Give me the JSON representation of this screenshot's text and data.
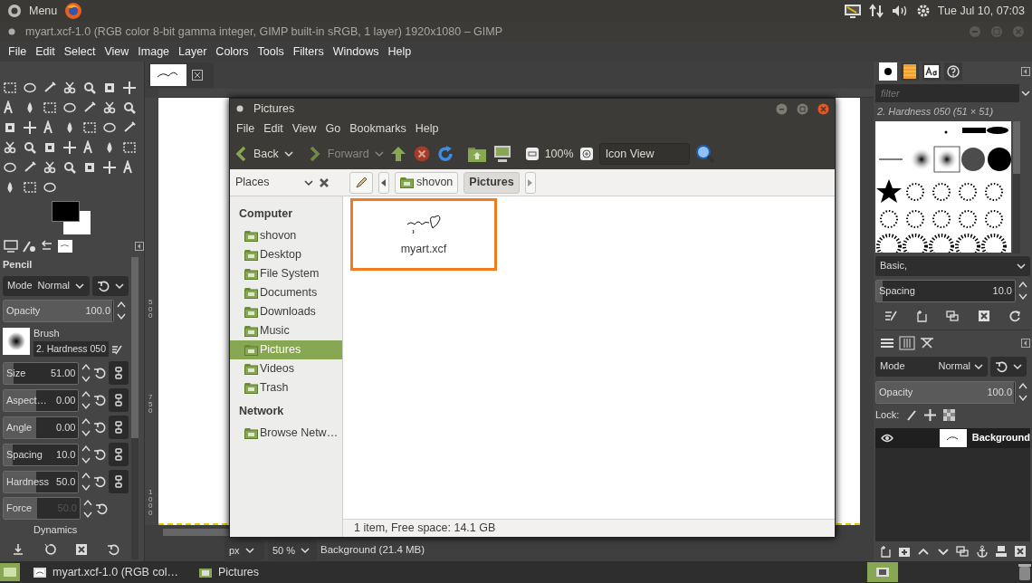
{
  "top_panel": {
    "menu": "Menu",
    "clock": "Tue Jul 10, 07:03"
  },
  "window": {
    "title": "myart.xcf-1.0 (RGB color 8-bit gamma integer, GIMP built-in sRGB, 1 layer) 1920x1080 – GIMP"
  },
  "menu_bar": [
    "File",
    "Edit",
    "Select",
    "View",
    "Image",
    "Layer",
    "Colors",
    "Tools",
    "Filters",
    "Windows",
    "Help"
  ],
  "tool_options": {
    "title": "Pencil",
    "mode": {
      "label": "Mode",
      "value": "Normal"
    },
    "opacity": {
      "label": "Opacity",
      "value": "100.0",
      "level": 1
    },
    "brush": {
      "label": "Brush",
      "value": "2. Hardness 050"
    },
    "sliders": [
      {
        "label": "Size",
        "value": "51.00",
        "level": 0.15,
        "kind": "linked",
        "disabled": false
      },
      {
        "label": "Aspect…",
        "value": "0.00",
        "level": 0.45,
        "kind": "linked",
        "disabled": false
      },
      {
        "label": "Angle",
        "value": "0.00",
        "level": 0.45,
        "kind": "linked",
        "disabled": false
      },
      {
        "label": "Spacing",
        "value": "10.0",
        "level": 0.13,
        "kind": "linked",
        "disabled": false
      },
      {
        "label": "Hardness",
        "value": "50.0",
        "level": 0.45,
        "kind": "linked",
        "disabled": false
      },
      {
        "label": "Force",
        "value": "50.0",
        "level": 0.45,
        "kind": "plain",
        "disabled": true
      }
    ],
    "dynamics": "Dynamics"
  },
  "canvas": {
    "ruler_labels": [
      "500",
      "750",
      "1000"
    ],
    "unit": "px",
    "zoom": "50 %",
    "status": "Background (21.4 MB)"
  },
  "file_manager": {
    "title": "Pictures",
    "menu": [
      "File",
      "Edit",
      "View",
      "Go",
      "Bookmarks",
      "Help"
    ],
    "toolbar": {
      "back": {
        "label": "Back",
        "disabled": false
      },
      "forward": {
        "label": "Forward",
        "disabled": true
      },
      "zoom": "100%",
      "view": "Icon View"
    },
    "places_label": "Places",
    "breadcrumbs": [
      {
        "label": "shovon",
        "selected": false
      },
      {
        "label": "Pictures",
        "selected": true
      }
    ],
    "sidebar": [
      {
        "heading": "Computer",
        "items": [
          {
            "label": "shovon",
            "selected": false
          },
          {
            "label": "Desktop",
            "selected": false
          },
          {
            "label": "File System",
            "selected": false
          },
          {
            "label": "Documents",
            "selected": false
          },
          {
            "label": "Downloads",
            "selected": false
          },
          {
            "label": "Music",
            "selected": false
          },
          {
            "label": "Pictures",
            "selected": true
          },
          {
            "label": "Videos",
            "selected": false
          },
          {
            "label": "Trash",
            "selected": false
          }
        ]
      },
      {
        "heading": "Network",
        "items": [
          {
            "label": "Browse Netw…",
            "selected": false
          }
        ]
      }
    ],
    "files": [
      {
        "name": "myart.xcf",
        "highlighted": true
      }
    ],
    "status": "1 item, Free space: 14.1 GB"
  },
  "dock": {
    "filter_placeholder": "filter",
    "brush_name": "2. Hardness 050 (51 × 51)",
    "tag": "Basic,",
    "spacing": {
      "label": "Spacing",
      "value": "10.0",
      "level": 0.05
    },
    "layers": {
      "mode": {
        "label": "Mode",
        "value": "Normal"
      },
      "opacity": {
        "label": "Opacity",
        "value": "100.0",
        "level": 1
      },
      "lock": "Lock:",
      "items": [
        {
          "name": "Background",
          "visible": true,
          "selected": true
        }
      ]
    }
  },
  "taskbar": [
    {
      "label": "myart.xcf-1.0 (RGB col…"
    },
    {
      "label": "Pictures"
    }
  ]
}
